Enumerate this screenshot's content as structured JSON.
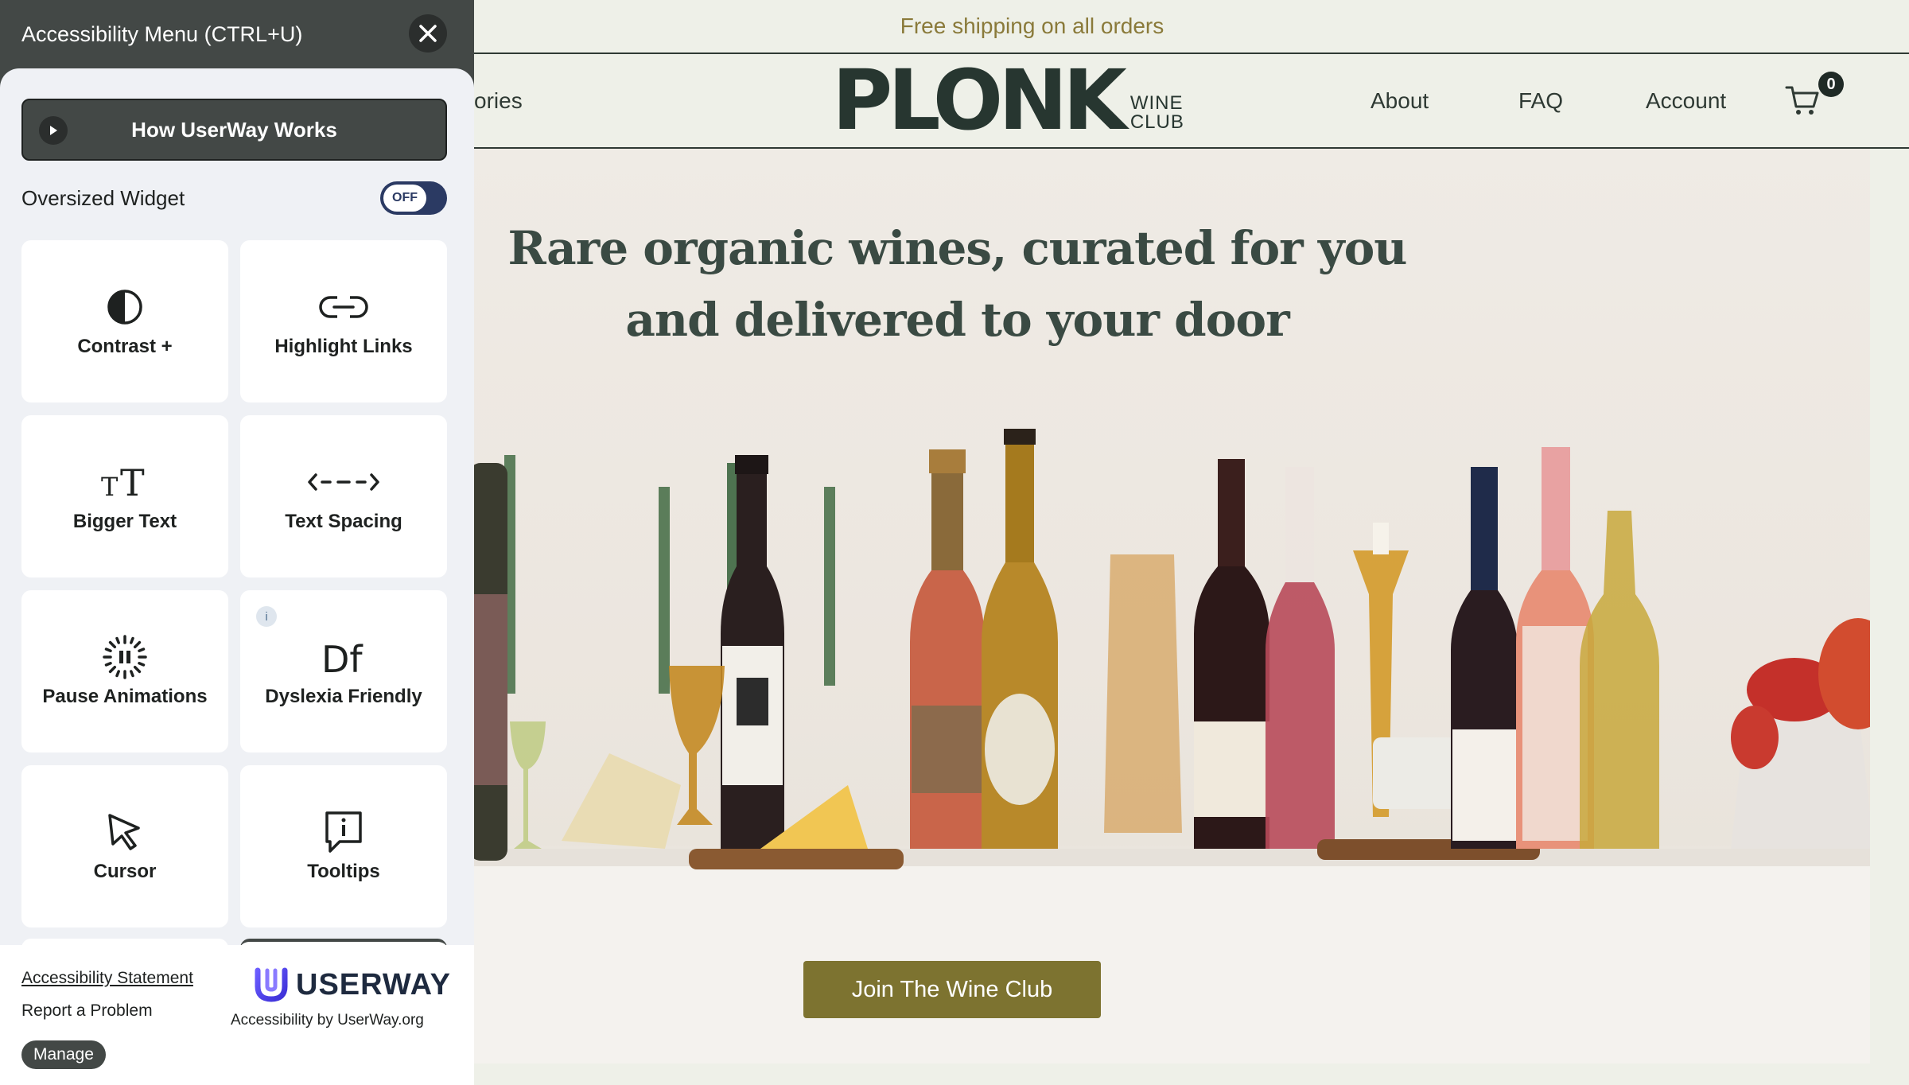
{
  "site": {
    "announcement": "Free shipping on all orders",
    "nav_partial": "ories",
    "logo_main": "PLONK",
    "logo_sub_line1": "WINE",
    "logo_sub_line2": "CLUB",
    "nav": [
      {
        "label": "About"
      },
      {
        "label": "FAQ"
      },
      {
        "label": "Account"
      }
    ],
    "cart_count": "0",
    "hero_title": "Rare organic wines, curated for you and delivered to your door",
    "cta_label": "Join The Wine Club"
  },
  "accessibility_menu": {
    "title": "Accessibility Menu (CTRL+U)",
    "how_button": "How UserWay Works",
    "oversized_label": "Oversized Widget",
    "oversized_state": "OFF",
    "tiles": [
      {
        "label": "Contrast +",
        "icon": "contrast-icon"
      },
      {
        "label": "Highlight Links",
        "icon": "link-icon"
      },
      {
        "label": "Bigger Text",
        "icon": "text-size-icon"
      },
      {
        "label": "Text Spacing",
        "icon": "text-spacing-icon"
      },
      {
        "label": "Pause Animations",
        "icon": "pause-icon"
      },
      {
        "label": "Dyslexia Friendly",
        "icon": "dyslexia-icon"
      },
      {
        "label": "Cursor",
        "icon": "cursor-icon"
      },
      {
        "label": "Tooltips",
        "icon": "tooltip-icon"
      }
    ],
    "info_badge": "i",
    "footer": {
      "statement_link": "Accessibility Statement",
      "report": "Report a Problem",
      "manage": "Manage",
      "brand": "USERWAY",
      "caption": "Accessibility by UserWay.org"
    }
  },
  "colors": {
    "panel_dark": "#434846",
    "panel_light": "#eff1f5",
    "toggle": "#2b3a63",
    "site_bg": "#eef0e8",
    "brand_olive": "#7d7330",
    "announce_text": "#8a7a3a"
  }
}
